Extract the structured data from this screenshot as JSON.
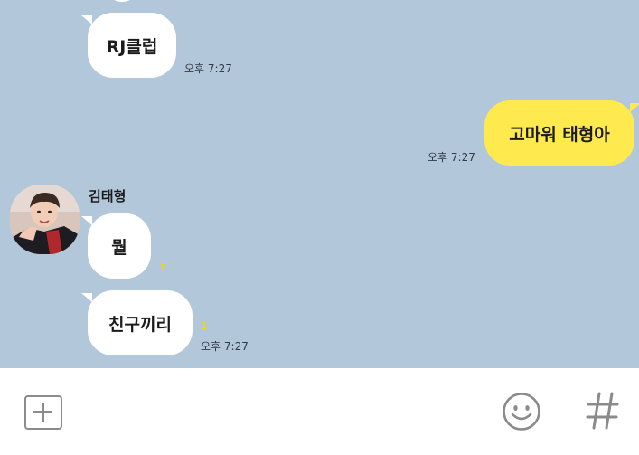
{
  "messages": [
    {
      "id": "m0",
      "direction": "in",
      "text": ""
    },
    {
      "id": "m1",
      "direction": "in",
      "text": "RJ클럽",
      "time": "오후 7:27"
    },
    {
      "id": "m2",
      "direction": "out",
      "text": "고마워 태형아",
      "time": "오후 7:27"
    },
    {
      "id": "m3",
      "direction": "in",
      "sender": "김태형",
      "text": "뭘",
      "unread": "1"
    },
    {
      "id": "m4",
      "direction": "in",
      "text": "친구끼리",
      "unread": "1",
      "time": "오후 7:27"
    }
  ],
  "input_bar": {
    "attach_icon": "plus-square-icon",
    "emoticon_icon": "smiley-icon",
    "hashtag_icon": "hashtag-icon"
  },
  "colors": {
    "chat_background": "#b2c7da",
    "incoming_bubble": "#ffffff",
    "outgoing_bubble": "#fee94e",
    "unread_count": "#f2d21a",
    "icon_gray": "#8b8b8b"
  }
}
